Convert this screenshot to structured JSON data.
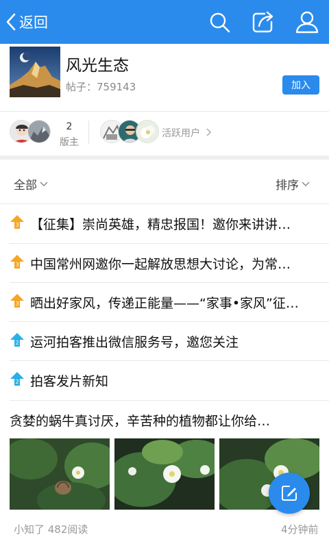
{
  "header": {
    "back_label": "返回",
    "icons": [
      "search-icon",
      "share-icon",
      "user-icon"
    ]
  },
  "forum": {
    "name": "风光生态",
    "posts_label": "帖子：759143",
    "join_label": "加入"
  },
  "members": {
    "moderator_count": "2",
    "moderator_label": "版主",
    "active_label": "活跃用户"
  },
  "filter": {
    "all_label": "全部",
    "sort_label": "排序"
  },
  "pinned_posts": [
    {
      "level": "3",
      "title": "【征集】崇尚英雄，精忠报国！邀你来讲讲…"
    },
    {
      "level": "3",
      "title": "中国常州网邀你一起解放思想大讨论，为常…"
    },
    {
      "level": "3",
      "title": "晒出好家风，传递正能量——“家事•家风”征…"
    },
    {
      "level": "2",
      "title": "运河拍客推出微信服务号，邀您关注"
    },
    {
      "level": "2",
      "title": "拍客发片新知"
    }
  ],
  "feature_post": {
    "title": "贪婪的蜗牛真讨厌，辛苦种的植物都让你给…",
    "meta": "小知了 482阅读",
    "time": "4分钟前"
  },
  "colors": {
    "brand": "#2a8bec",
    "pin_level3": "#f5a623",
    "pin_level2": "#29b0e8"
  }
}
